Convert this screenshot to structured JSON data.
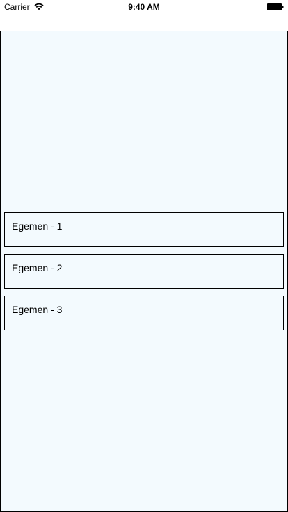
{
  "status_bar": {
    "carrier": "Carrier",
    "time": "9:40 AM",
    "wifi_icon": "wifi-icon",
    "battery_icon": "battery-icon"
  },
  "screen": {
    "background_color": "#f3fafe",
    "items": [
      {
        "label": "Egemen - 1"
      },
      {
        "label": "Egemen - 2"
      },
      {
        "label": "Egemen - 3"
      }
    ]
  }
}
